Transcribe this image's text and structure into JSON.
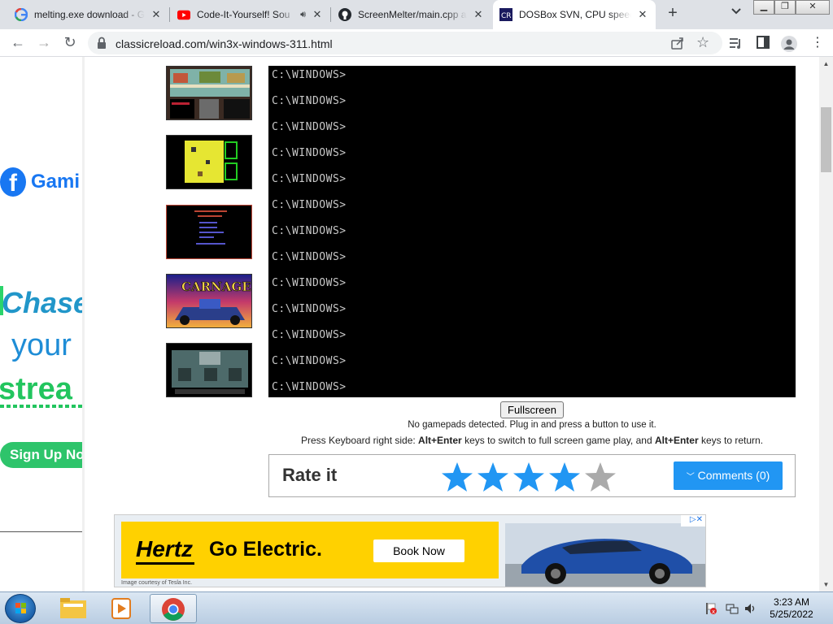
{
  "browser": {
    "tabs": [
      {
        "title": "melting.exe download - G",
        "favicon": "google-g-icon",
        "active": false
      },
      {
        "title": "Code-It-Yourself! Sou",
        "favicon": "youtube-icon",
        "active": false,
        "audio": true
      },
      {
        "title": "ScreenMelter/main.cpp at",
        "favicon": "github-icon",
        "active": false
      },
      {
        "title": "DOSBox SVN, CPU speed:",
        "favicon": "classicreload-icon",
        "active": true
      }
    ],
    "new_tab_label": "+",
    "url": "classicreload.com/win3x-windows-311.html"
  },
  "left_ad": {
    "gami": "Gami",
    "chase": "Chase",
    "your": "your",
    "strea": "strea",
    "signup": "Sign Up Now"
  },
  "dos": {
    "prompt": "C:\\WINDOWS>",
    "lines": [
      "C:\\WINDOWS>",
      "C:\\WINDOWS>",
      "C:\\WINDOWS>",
      "C:\\WINDOWS>",
      "C:\\WINDOWS>",
      "C:\\WINDOWS>",
      "C:\\WINDOWS>",
      "C:\\WINDOWS>",
      "C:\\WINDOWS>",
      "C:\\WINDOWS>",
      "C:\\WINDOWS>",
      "C:\\WINDOWS>",
      "C:\\WINDOWS>"
    ]
  },
  "controls": {
    "fullscreen_label": "Fullscreen",
    "gamepad_note": "No gamepads detected. Plug in and press a button to use it.",
    "keys_prefix": "Press Keyboard right side: ",
    "keys_combo1": "Alt+Enter",
    "keys_middle": " keys to switch to full screen game play, and ",
    "keys_combo2": "Alt+Enter",
    "keys_suffix": " keys to return."
  },
  "rating": {
    "title": "Rate it",
    "stars_filled": 4,
    "stars_total": 5,
    "comments_label": "Comments (0)",
    "star_color": "#2196f3",
    "star_empty_color": "#aaaaaa"
  },
  "bottom_ad": {
    "brand": "Hertz",
    "headline": "Go Electric.",
    "cta": "Book Now",
    "credit": "Image courtesy of Tesla Inc."
  },
  "taskbar": {
    "time": "3:23 AM",
    "date": "5/25/2022"
  }
}
